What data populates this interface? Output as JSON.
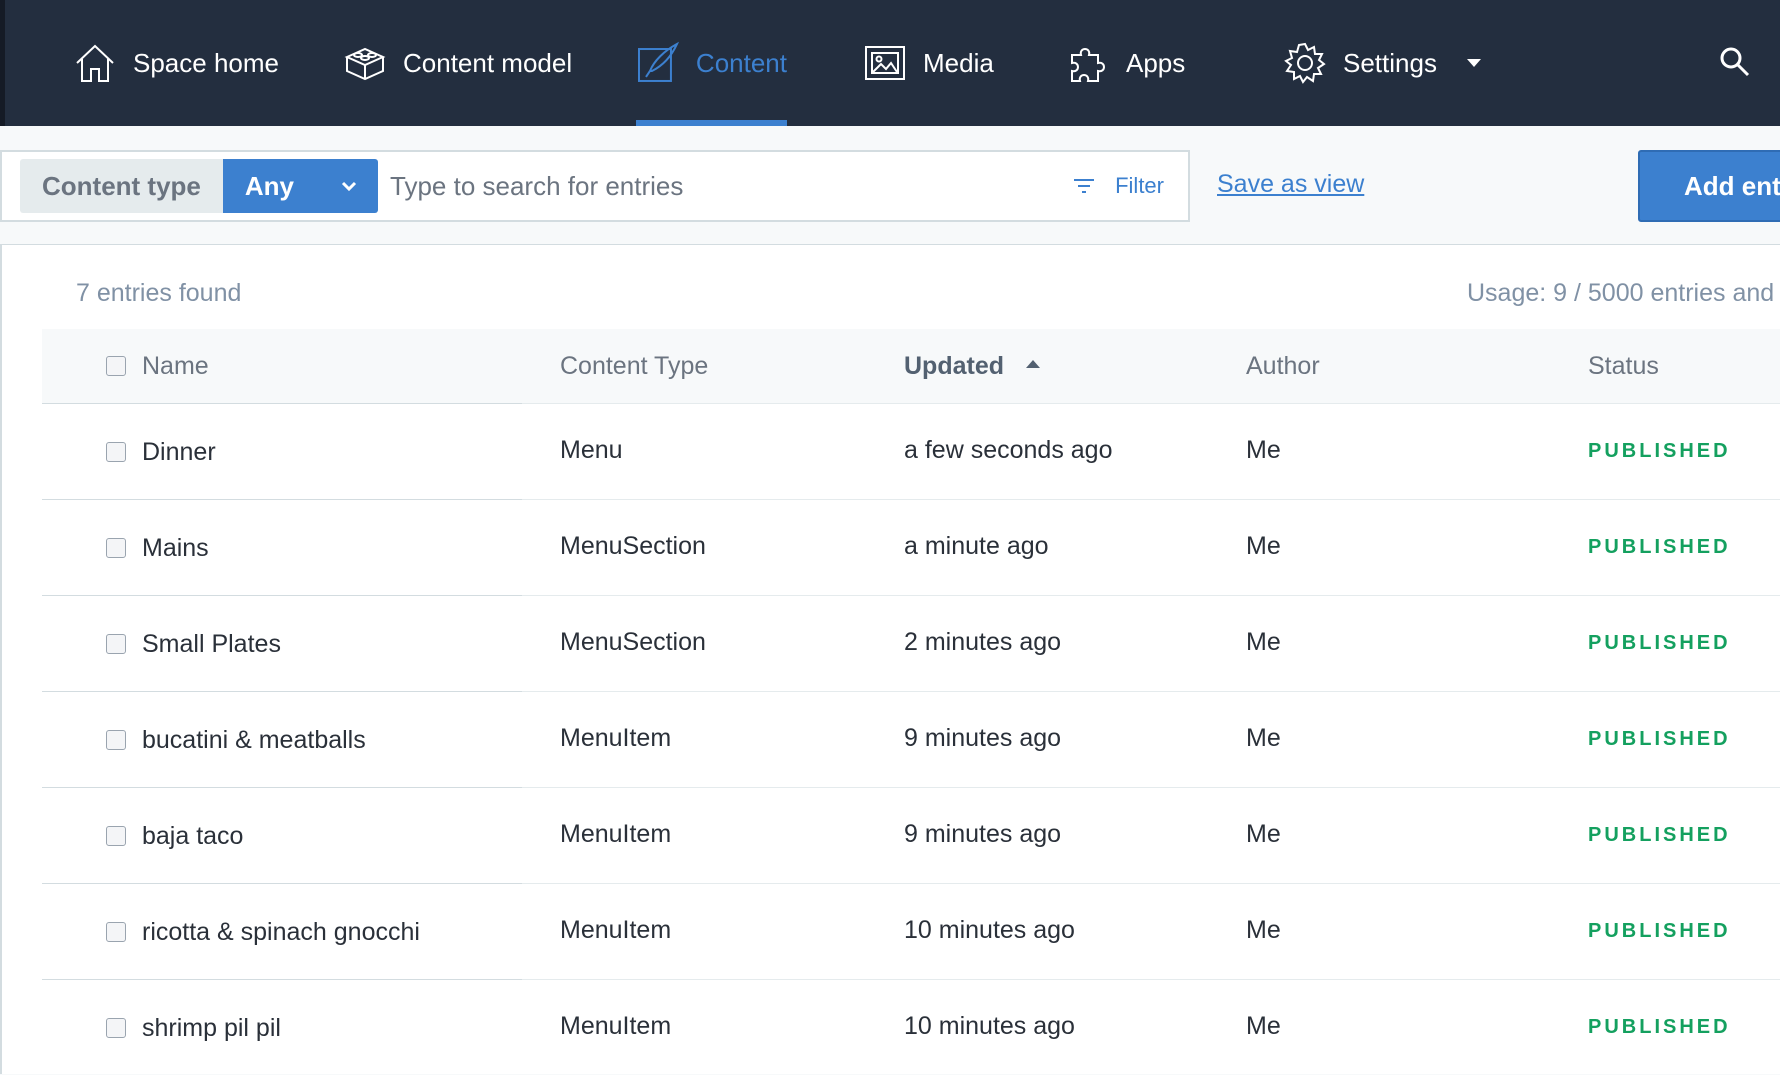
{
  "nav": {
    "items": [
      {
        "label": "Space home",
        "icon": "home-icon"
      },
      {
        "label": "Content model",
        "icon": "content-model-icon"
      },
      {
        "label": "Content",
        "icon": "content-icon",
        "active": true
      },
      {
        "label": "Media",
        "icon": "media-icon"
      },
      {
        "label": "Apps",
        "icon": "apps-icon"
      },
      {
        "label": "Settings",
        "icon": "gear-icon"
      }
    ],
    "search_icon": "search-icon"
  },
  "search": {
    "content_type_label": "Content type",
    "content_type_value": "Any",
    "placeholder": "Type to search for entries",
    "filter_label": "Filter",
    "save_as_view_label": "Save as view",
    "add_entry_label": "Add entry"
  },
  "results": {
    "found_text": "7 entries found",
    "usage_text": "Usage: 9 / 5000 entries and"
  },
  "table": {
    "columns": {
      "name": "Name",
      "content_type": "Content Type",
      "updated": "Updated",
      "author": "Author",
      "status": "Status"
    },
    "rows": [
      {
        "name": "Dinner",
        "content_type": "Menu",
        "updated": "a few seconds ago",
        "author": "Me",
        "status": "PUBLISHED"
      },
      {
        "name": "Mains",
        "content_type": "MenuSection",
        "updated": "a minute ago",
        "author": "Me",
        "status": "PUBLISHED"
      },
      {
        "name": "Small Plates",
        "content_type": "MenuSection",
        "updated": "2 minutes ago",
        "author": "Me",
        "status": "PUBLISHED"
      },
      {
        "name": "bucatini & meatballs",
        "content_type": "MenuItem",
        "updated": "9 minutes ago",
        "author": "Me",
        "status": "PUBLISHED"
      },
      {
        "name": "baja taco",
        "content_type": "MenuItem",
        "updated": "9 minutes ago",
        "author": "Me",
        "status": "PUBLISHED"
      },
      {
        "name": "ricotta & spinach gnocchi",
        "content_type": "MenuItem",
        "updated": "10 minutes ago",
        "author": "Me",
        "status": "PUBLISHED"
      },
      {
        "name": "shrimp pil pil",
        "content_type": "MenuItem",
        "updated": "10 minutes ago",
        "author": "Me",
        "status": "PUBLISHED"
      }
    ]
  },
  "colors": {
    "nav_bg": "#232e3f",
    "accent": "#3c80cf",
    "published": "#14a05f"
  }
}
